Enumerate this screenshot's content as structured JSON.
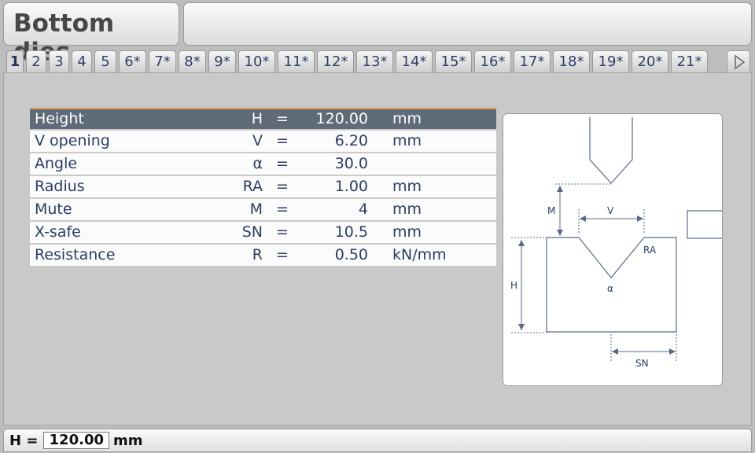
{
  "window": {
    "title": "Bottom dies"
  },
  "tabs": [
    "1",
    "2",
    "3",
    "4",
    "5",
    "6*",
    "7*",
    "8*",
    "9*",
    "10*",
    "11*",
    "12*",
    "13*",
    "14*",
    "15*",
    "16*",
    "17*",
    "18*",
    "19*",
    "20*",
    "21*"
  ],
  "params": [
    {
      "name": "Height",
      "symbol": "H",
      "eq": "=",
      "value": "120.00",
      "unit": "mm"
    },
    {
      "name": "V opening",
      "symbol": "V",
      "eq": "=",
      "value": "6.20",
      "unit": "mm"
    },
    {
      "name": "Angle",
      "symbol": "α",
      "eq": "=",
      "value": "30.0",
      "unit": ""
    },
    {
      "name": "Radius",
      "symbol": "RA",
      "eq": "=",
      "value": "1.00",
      "unit": "mm"
    },
    {
      "name": "Mute",
      "symbol": "M",
      "eq": "=",
      "value": "4",
      "unit": "mm"
    },
    {
      "name": "X-safe",
      "symbol": "SN",
      "eq": "=",
      "value": "10.5",
      "unit": "mm"
    },
    {
      "name": "Resistance",
      "symbol": "R",
      "eq": "=",
      "value": "0.50",
      "unit": "kN/mm"
    }
  ],
  "diagram": {
    "M": "M",
    "V": "V",
    "RA": "RA",
    "H": "H",
    "alpha": "α",
    "SN": "SN"
  },
  "status": {
    "label": "H =",
    "value": "120.00",
    "unit": "mm"
  },
  "colors": {
    "selected_row": "#5f6b78",
    "selected_accent": "#d9a050",
    "text": "#2b3d63"
  }
}
